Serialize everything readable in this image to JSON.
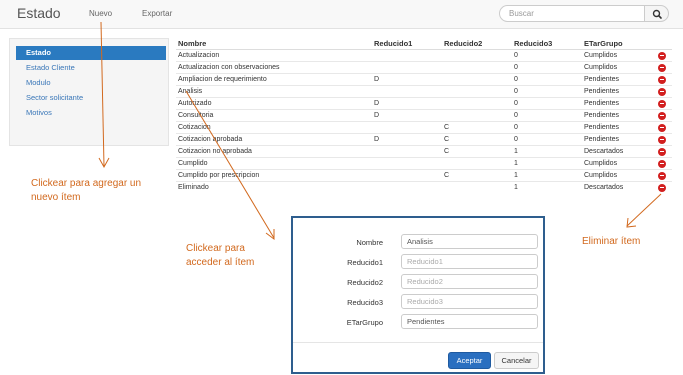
{
  "navbar": {
    "brand": "Estado",
    "links": [
      "Nuevo",
      "Exportar"
    ],
    "search_placeholder": "Buscar"
  },
  "sidebar": {
    "items": [
      "Estado",
      "Estado Cliente",
      "Modulo",
      "Sector solicitante",
      "Motivos"
    ],
    "active_index": 0
  },
  "table": {
    "columns": [
      "Nombre",
      "Reducido1",
      "Reducido2",
      "Reducido3",
      "ETarGrupo"
    ],
    "rows": [
      [
        "Actualizacion",
        "",
        "",
        "0",
        "Cumplidos"
      ],
      [
        "Actualizacion con observaciones",
        "",
        "",
        "0",
        "Cumplidos"
      ],
      [
        "Ampliacion de requerimiento",
        "D",
        "",
        "0",
        "Pendientes"
      ],
      [
        "Analisis",
        "",
        "",
        "0",
        "Pendientes"
      ],
      [
        "Autorizado",
        "D",
        "",
        "0",
        "Pendientes"
      ],
      [
        "Consultoria",
        "D",
        "",
        "0",
        "Pendientes"
      ],
      [
        "Cotizacion",
        "",
        "C",
        "0",
        "Pendientes"
      ],
      [
        "Cotizacion aprobada",
        "D",
        "C",
        "0",
        "Pendientes"
      ],
      [
        "Cotizacion no aprobada",
        "",
        "C",
        "1",
        "Descartados"
      ],
      [
        "Cumplido",
        "",
        "",
        "1",
        "Cumplidos"
      ],
      [
        "Cumplido por prescripcion",
        "",
        "C",
        "1",
        "Cumplidos"
      ],
      [
        "Eliminado",
        "",
        "",
        "1",
        "Descartados"
      ]
    ]
  },
  "annotations": {
    "add": "Clickear para agregar un nuevo ítem",
    "access": "Clickear para acceder al ítem",
    "delete": "Eliminar ítem"
  },
  "modal": {
    "fields": [
      {
        "label": "Nombre",
        "value": "Analisis",
        "placeholder": ""
      },
      {
        "label": "Reducido1",
        "value": "",
        "placeholder": "Reducido1"
      },
      {
        "label": "Reducido2",
        "value": "",
        "placeholder": "Reducido2"
      },
      {
        "label": "Reducido3",
        "value": "",
        "placeholder": "Reducido3"
      },
      {
        "label": "ETarGrupo",
        "value": "Pendientes",
        "placeholder": ""
      }
    ],
    "accept_label": "Aceptar",
    "cancel_label": "Cancelar"
  },
  "colors": {
    "annotation": "#d2691e",
    "primary": "#2a7ac0",
    "delete": "#d21f1f"
  }
}
